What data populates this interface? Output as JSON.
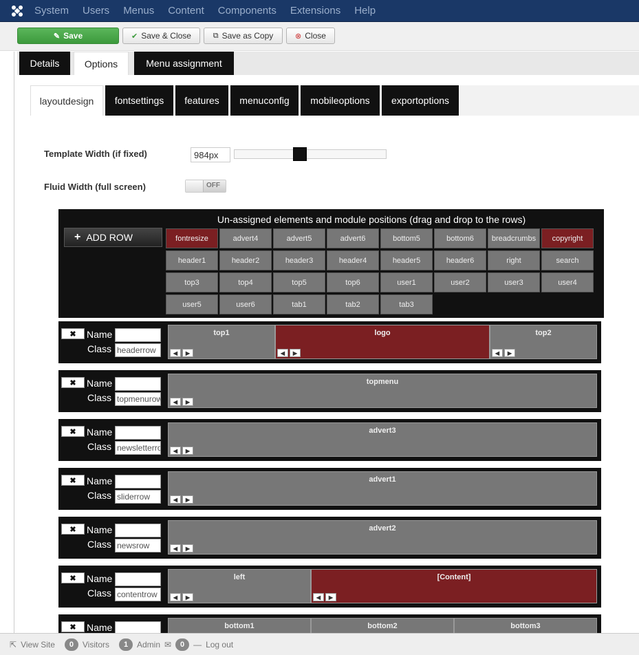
{
  "nav": {
    "items": [
      "System",
      "Users",
      "Menus",
      "Content",
      "Components",
      "Extensions",
      "Help"
    ]
  },
  "toolbar": {
    "save": "Save",
    "save_close": "Save & Close",
    "save_copy": "Save as Copy",
    "close": "Close"
  },
  "main_tabs": [
    "Details",
    "Options",
    "Menu assignment"
  ],
  "sub_tabs": [
    "layoutdesign",
    "fontsettings",
    "features",
    "menuconfig",
    "mobileoptions",
    "exportoptions"
  ],
  "options": {
    "template_width_label": "Template Width (if fixed)",
    "template_width_value": "984px",
    "fluid_width_label": "Fluid Width (full screen)",
    "fluid_toggle": "OFF"
  },
  "unassigned": {
    "title": "Un-assigned elements and module positions (drag and drop to the rows)",
    "add_row": "ADD ROW",
    "chips": [
      "fontresize",
      "advert4",
      "advert5",
      "advert6",
      "bottom5",
      "bottom6",
      "breadcrumbs",
      "copyright",
      "header1",
      "header2",
      "header3",
      "header4",
      "header5",
      "header6",
      "right",
      "search",
      "top3",
      "top4",
      "top5",
      "top6",
      "user1",
      "user2",
      "user3",
      "user4",
      "user5",
      "user6",
      "tab1",
      "tab2",
      "tab3"
    ]
  },
  "rows": {
    "name_label": "Name",
    "class_label": "Class",
    "r0": {
      "class": "headerrow",
      "cells": [
        "top1",
        "logo",
        "top2"
      ]
    },
    "r1": {
      "class": "topmenurow",
      "cells": [
        "topmenu"
      ]
    },
    "r2": {
      "class": "newsletterrow",
      "cells": [
        "advert3"
      ]
    },
    "r3": {
      "class": "sliderrow",
      "cells": [
        "advert1"
      ]
    },
    "r4": {
      "class": "newsrow",
      "cells": [
        "advert2"
      ]
    },
    "r5": {
      "class": "contentrow",
      "cells": [
        "left",
        "[Content]"
      ]
    },
    "r6": {
      "class": "",
      "cells": [
        "bottom1",
        "bottom2",
        "bottom3"
      ]
    }
  },
  "status": {
    "view_site": "View Site",
    "visitors_count": "0",
    "visitors": "Visitors",
    "admin_count": "1",
    "admin": "Admin",
    "messages_count": "0",
    "logout": "Log out"
  },
  "colors": {
    "nav_bg": "#1a3867",
    "save_green": "#46a546",
    "module_red": "#7b1f22",
    "module_gray": "#777777"
  }
}
